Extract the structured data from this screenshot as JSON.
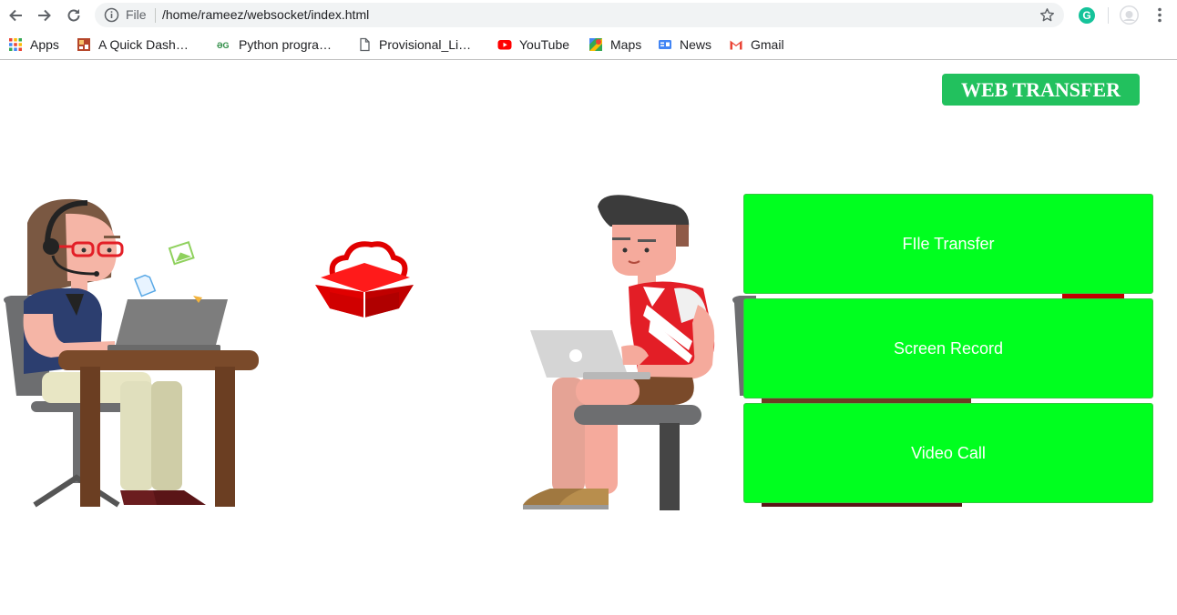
{
  "browser": {
    "address": {
      "scheme_label": "File",
      "url": "/home/rameez/websocket/index.html"
    },
    "icons": {
      "back": "arrow-left-icon",
      "forward": "arrow-right-icon",
      "reload": "reload-icon",
      "info": "info-icon",
      "bookmark_star": "star-icon",
      "extension": "grammarly-icon",
      "profile": "profile-icon",
      "menu": "more-vertical-icon"
    },
    "extension_letter": "G"
  },
  "bookmarks": [
    {
      "label": "Apps",
      "icon": "apps-grid-icon"
    },
    {
      "label": "A Quick Dash…",
      "icon": "dashboard-favicon-icon"
    },
    {
      "label": "Python progra…",
      "icon": "geeksforgeeks-favicon-icon"
    },
    {
      "label": "Provisional_Li…",
      "icon": "document-icon"
    },
    {
      "label": "YouTube",
      "icon": "youtube-icon"
    },
    {
      "label": "Maps",
      "icon": "maps-icon"
    },
    {
      "label": "News",
      "icon": "news-icon"
    },
    {
      "label": "Gmail",
      "icon": "gmail-icon"
    }
  ],
  "page": {
    "brand_button": "WEB TRANSFER",
    "actions": [
      {
        "label": "FIle Transfer"
      },
      {
        "label": "Screen Record"
      },
      {
        "label": "Video Call"
      }
    ],
    "colors": {
      "brand": "#22c15e",
      "action_bg": "#00ff1f",
      "cloud_box": "#e00000"
    }
  }
}
